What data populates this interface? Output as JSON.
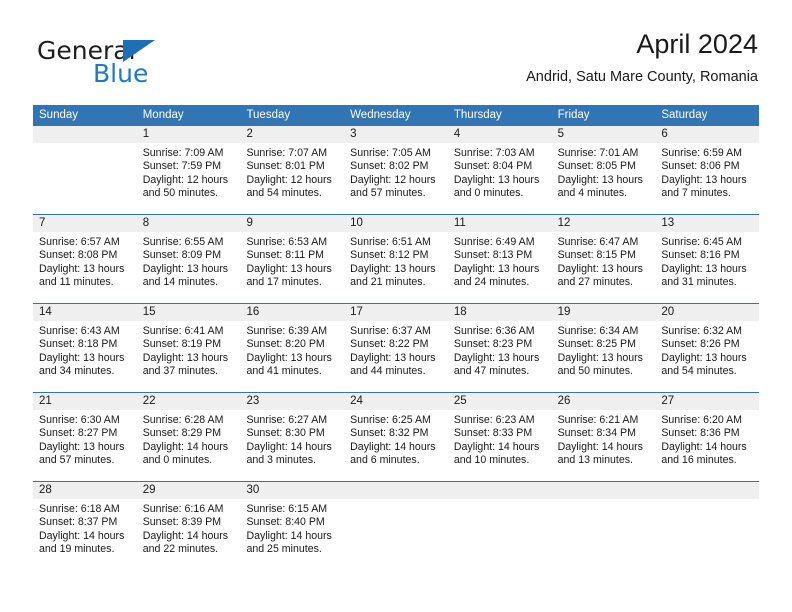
{
  "brand": {
    "word_general": "General",
    "word_blue": "Blue",
    "triangle_color": "#1e6fb8",
    "blue_color": "#1e7ac4"
  },
  "header": {
    "title": "April 2024",
    "subtitle": "Andrid, Satu Mare County, Romania"
  },
  "theme": {
    "header_bg": "#3275b5",
    "daynum_bg": "#efefef",
    "rule_color": "#3275b5",
    "text_color": "#1a1a1a"
  },
  "calendar": {
    "weekday_headers": [
      "Sunday",
      "Monday",
      "Tuesday",
      "Wednesday",
      "Thursday",
      "Friday",
      "Saturday"
    ],
    "weeks": [
      [
        {
          "day": "",
          "lines": []
        },
        {
          "day": "1",
          "lines": [
            "Sunrise: 7:09 AM",
            "Sunset: 7:59 PM",
            "Daylight: 12 hours",
            "and 50 minutes."
          ]
        },
        {
          "day": "2",
          "lines": [
            "Sunrise: 7:07 AM",
            "Sunset: 8:01 PM",
            "Daylight: 12 hours",
            "and 54 minutes."
          ]
        },
        {
          "day": "3",
          "lines": [
            "Sunrise: 7:05 AM",
            "Sunset: 8:02 PM",
            "Daylight: 12 hours",
            "and 57 minutes."
          ]
        },
        {
          "day": "4",
          "lines": [
            "Sunrise: 7:03 AM",
            "Sunset: 8:04 PM",
            "Daylight: 13 hours",
            "and 0 minutes."
          ]
        },
        {
          "day": "5",
          "lines": [
            "Sunrise: 7:01 AM",
            "Sunset: 8:05 PM",
            "Daylight: 13 hours",
            "and 4 minutes."
          ]
        },
        {
          "day": "6",
          "lines": [
            "Sunrise: 6:59 AM",
            "Sunset: 8:06 PM",
            "Daylight: 13 hours",
            "and 7 minutes."
          ]
        }
      ],
      [
        {
          "day": "7",
          "lines": [
            "Sunrise: 6:57 AM",
            "Sunset: 8:08 PM",
            "Daylight: 13 hours",
            "and 11 minutes."
          ]
        },
        {
          "day": "8",
          "lines": [
            "Sunrise: 6:55 AM",
            "Sunset: 8:09 PM",
            "Daylight: 13 hours",
            "and 14 minutes."
          ]
        },
        {
          "day": "9",
          "lines": [
            "Sunrise: 6:53 AM",
            "Sunset: 8:11 PM",
            "Daylight: 13 hours",
            "and 17 minutes."
          ]
        },
        {
          "day": "10",
          "lines": [
            "Sunrise: 6:51 AM",
            "Sunset: 8:12 PM",
            "Daylight: 13 hours",
            "and 21 minutes."
          ]
        },
        {
          "day": "11",
          "lines": [
            "Sunrise: 6:49 AM",
            "Sunset: 8:13 PM",
            "Daylight: 13 hours",
            "and 24 minutes."
          ]
        },
        {
          "day": "12",
          "lines": [
            "Sunrise: 6:47 AM",
            "Sunset: 8:15 PM",
            "Daylight: 13 hours",
            "and 27 minutes."
          ]
        },
        {
          "day": "13",
          "lines": [
            "Sunrise: 6:45 AM",
            "Sunset: 8:16 PM",
            "Daylight: 13 hours",
            "and 31 minutes."
          ]
        }
      ],
      [
        {
          "day": "14",
          "lines": [
            "Sunrise: 6:43 AM",
            "Sunset: 8:18 PM",
            "Daylight: 13 hours",
            "and 34 minutes."
          ]
        },
        {
          "day": "15",
          "lines": [
            "Sunrise: 6:41 AM",
            "Sunset: 8:19 PM",
            "Daylight: 13 hours",
            "and 37 minutes."
          ]
        },
        {
          "day": "16",
          "lines": [
            "Sunrise: 6:39 AM",
            "Sunset: 8:20 PM",
            "Daylight: 13 hours",
            "and 41 minutes."
          ]
        },
        {
          "day": "17",
          "lines": [
            "Sunrise: 6:37 AM",
            "Sunset: 8:22 PM",
            "Daylight: 13 hours",
            "and 44 minutes."
          ]
        },
        {
          "day": "18",
          "lines": [
            "Sunrise: 6:36 AM",
            "Sunset: 8:23 PM",
            "Daylight: 13 hours",
            "and 47 minutes."
          ]
        },
        {
          "day": "19",
          "lines": [
            "Sunrise: 6:34 AM",
            "Sunset: 8:25 PM",
            "Daylight: 13 hours",
            "and 50 minutes."
          ]
        },
        {
          "day": "20",
          "lines": [
            "Sunrise: 6:32 AM",
            "Sunset: 8:26 PM",
            "Daylight: 13 hours",
            "and 54 minutes."
          ]
        }
      ],
      [
        {
          "day": "21",
          "lines": [
            "Sunrise: 6:30 AM",
            "Sunset: 8:27 PM",
            "Daylight: 13 hours",
            "and 57 minutes."
          ]
        },
        {
          "day": "22",
          "lines": [
            "Sunrise: 6:28 AM",
            "Sunset: 8:29 PM",
            "Daylight: 14 hours",
            "and 0 minutes."
          ]
        },
        {
          "day": "23",
          "lines": [
            "Sunrise: 6:27 AM",
            "Sunset: 8:30 PM",
            "Daylight: 14 hours",
            "and 3 minutes."
          ]
        },
        {
          "day": "24",
          "lines": [
            "Sunrise: 6:25 AM",
            "Sunset: 8:32 PM",
            "Daylight: 14 hours",
            "and 6 minutes."
          ]
        },
        {
          "day": "25",
          "lines": [
            "Sunrise: 6:23 AM",
            "Sunset: 8:33 PM",
            "Daylight: 14 hours",
            "and 10 minutes."
          ]
        },
        {
          "day": "26",
          "lines": [
            "Sunrise: 6:21 AM",
            "Sunset: 8:34 PM",
            "Daylight: 14 hours",
            "and 13 minutes."
          ]
        },
        {
          "day": "27",
          "lines": [
            "Sunrise: 6:20 AM",
            "Sunset: 8:36 PM",
            "Daylight: 14 hours",
            "and 16 minutes."
          ]
        }
      ],
      [
        {
          "day": "28",
          "lines": [
            "Sunrise: 6:18 AM",
            "Sunset: 8:37 PM",
            "Daylight: 14 hours",
            "and 19 minutes."
          ]
        },
        {
          "day": "29",
          "lines": [
            "Sunrise: 6:16 AM",
            "Sunset: 8:39 PM",
            "Daylight: 14 hours",
            "and 22 minutes."
          ]
        },
        {
          "day": "30",
          "lines": [
            "Sunrise: 6:15 AM",
            "Sunset: 8:40 PM",
            "Daylight: 14 hours",
            "and 25 minutes."
          ]
        },
        {
          "day": "",
          "lines": []
        },
        {
          "day": "",
          "lines": []
        },
        {
          "day": "",
          "lines": []
        },
        {
          "day": "",
          "lines": []
        }
      ]
    ]
  }
}
